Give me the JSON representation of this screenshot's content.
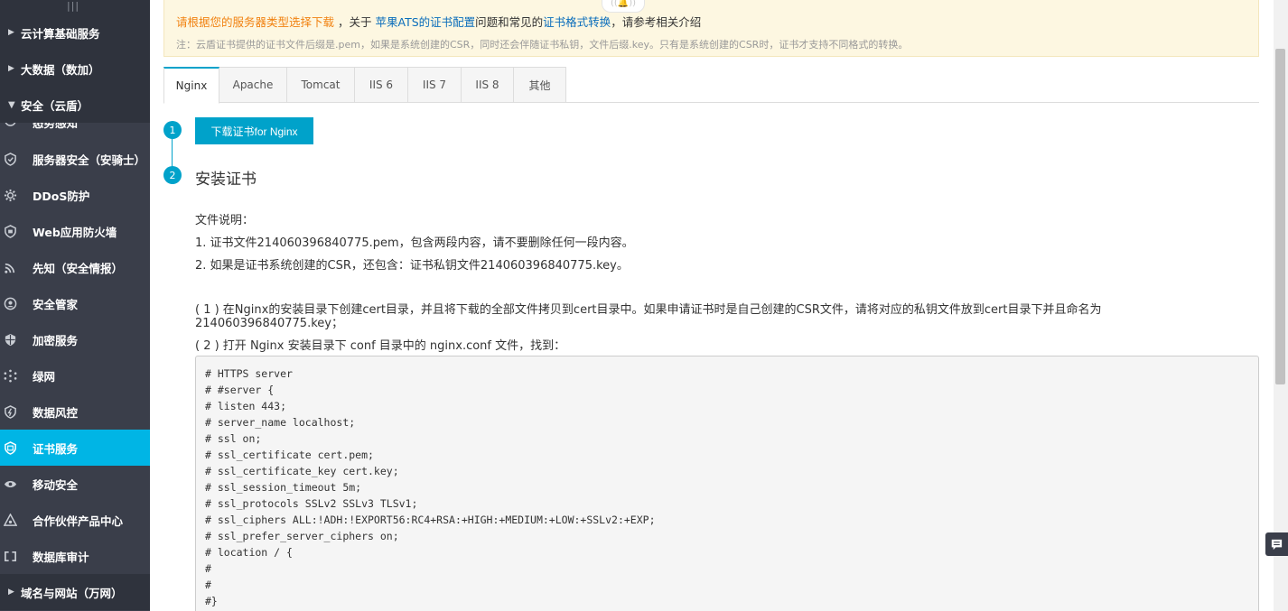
{
  "sidebar": {
    "top_stub_icon": "|||",
    "groups_top": [
      {
        "label": "云计算基础服务"
      },
      {
        "label": "大数据（数加）"
      },
      {
        "label": "安全（云盾）"
      }
    ],
    "partial_item": {
      "label": "态势感知",
      "icon": "eye-icon"
    },
    "items": [
      {
        "label": "服务器安全（安骑士）",
        "icon": "shield-icon"
      },
      {
        "label": "DDoS防护",
        "icon": "gear-icon"
      },
      {
        "label": "Web应用防火墙",
        "icon": "firewall-icon"
      },
      {
        "label": "先知（安全情报）",
        "icon": "signal-icon"
      },
      {
        "label": "安全管家",
        "icon": "headset-icon"
      },
      {
        "label": "加密服务",
        "icon": "encrypt-icon"
      },
      {
        "label": "绿网",
        "icon": "network-icon"
      },
      {
        "label": "数据风控",
        "icon": "data-risk-icon"
      },
      {
        "label": "证书服务",
        "icon": "certificate-icon"
      },
      {
        "label": "移动安全",
        "icon": "mobile-security-icon"
      },
      {
        "label": "合作伙伴产品中心",
        "icon": "partner-icon"
      },
      {
        "label": "数据库审计",
        "icon": "db-audit-icon"
      }
    ],
    "groups_bottom": [
      {
        "label": "域名与网站（万网）"
      }
    ],
    "active_color": "#00b5e5"
  },
  "notice": {
    "part1": "请根据您的服务器类型选择下载",
    "part2": "，关于",
    "link1": "苹果ATS的证书配置",
    "part3": "问题和常见的",
    "link2": "证书格式转换",
    "part4": "，请参考相关介绍",
    "note": "注：云盾证书提供的证书文件后缀是.pem，如果是系统创建的CSR，同时还会伴随证书私钥，文件后缀.key。只有是系统创建的CSR时，证书才支持不同格式的转换。"
  },
  "tabs": [
    {
      "label": "Nginx",
      "active": true
    },
    {
      "label": "Apache",
      "active": false
    },
    {
      "label": "Tomcat",
      "active": false
    },
    {
      "label": "IIS 6",
      "active": false
    },
    {
      "label": "IIS 7",
      "active": false
    },
    {
      "label": "IIS 8",
      "active": false
    },
    {
      "label": "其他",
      "active": false
    }
  ],
  "steps": {
    "step1_num": "1",
    "step2_num": "2",
    "download_label": "下载证书for Nginx",
    "install_title": "安装证书"
  },
  "content": {
    "file_desc_title": "文件说明：",
    "file1": "1. 证书文件214060396840775.pem，包含两段内容，请不要删除任何一段内容。",
    "file2": "2. 如果是证书系统创建的CSR，还包含：证书私钥文件214060396840775.key。",
    "instr1": "( 1 ) 在Nginx的安装目录下创建cert目录，并且将下载的全部文件拷贝到cert目录中。如果申请证书时是自己创建的CSR文件，请将对应的私钥文件放到cert目录下并且命名为214060396840775.key；",
    "instr2": "( 2 ) 打开 Nginx 安装目录下 conf 目录中的 nginx.conf 文件，找到："
  },
  "code_lines": [
    "# HTTPS server",
    "# #server {",
    "# listen 443;",
    "# server_name localhost;",
    "# ssl on;",
    "# ssl_certificate cert.pem;",
    "# ssl_certificate_key cert.key;",
    "# ssl_session_timeout 5m;",
    "# ssl_protocols SSLv2 SSLv3 TLSv1;",
    "# ssl_ciphers ALL:!ADH:!EXPORT56:RC4+RSA:+HIGH:+MEDIUM:+LOW:+SSLv2:+EXP;",
    "# ssl_prefer_server_ciphers on;",
    "# location / {",
    "#",
    "#",
    "#}"
  ],
  "feedback_icon": "chat-bubble-icon",
  "bell_icon": "bell-icon"
}
